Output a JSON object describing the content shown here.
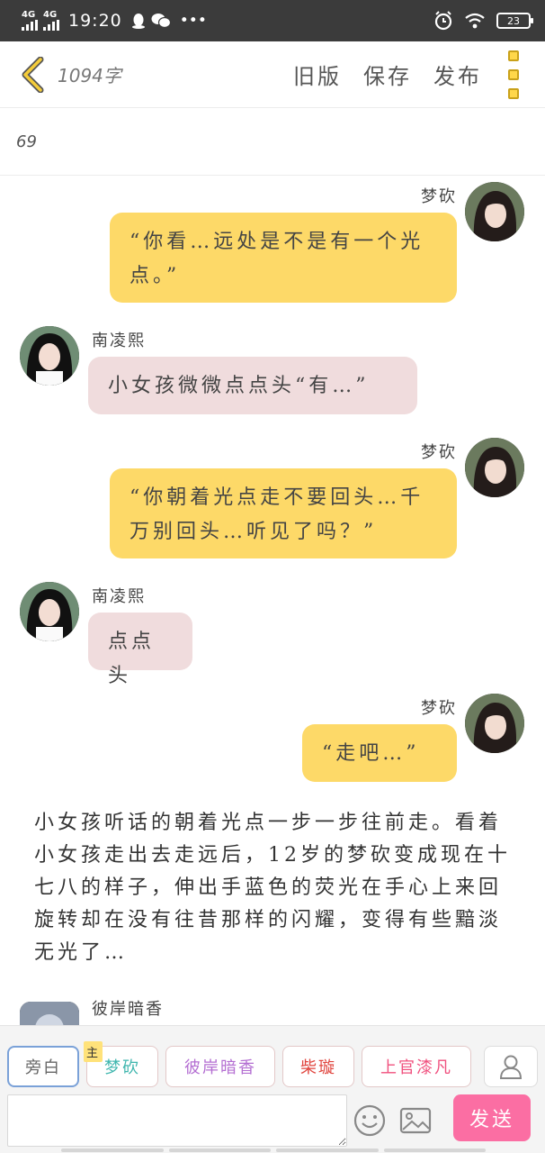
{
  "status_bar": {
    "network_1": "4G",
    "network_2": "4G",
    "time": "19:20",
    "extra": "•••",
    "battery": "23"
  },
  "header": {
    "word_count": "1094字",
    "actions": [
      "旧版",
      "保存",
      "发布"
    ]
  },
  "title": "69",
  "messages": [
    {
      "side": "right",
      "name": "梦砍",
      "text": "“你看…远处是不是有一个光点。”"
    },
    {
      "side": "left",
      "name": "南凌熙",
      "text": "小女孩微微点点头“有…”"
    },
    {
      "side": "right",
      "name": "梦砍",
      "text": "“你朝着光点走不要回头…千万别回头…听见了吗？”"
    },
    {
      "side": "left",
      "name": "南凌熙",
      "text": "点点头"
    },
    {
      "side": "right",
      "name": "梦砍",
      "text": "“走吧…”"
    }
  ],
  "narration": "小女孩听话的朝着光点一步一步往前走。看着小女孩走出去走远后，12岁的梦砍变成现在十七八的样子，伸出手蓝色的荧光在手心上来回旋转却在没有往昔那样的闪耀，变得有些黯淡无光了…",
  "partial_message": {
    "name": "彼岸暗香"
  },
  "roles": [
    {
      "label": "旁白",
      "color": "#666666",
      "active": true
    },
    {
      "label": "梦砍",
      "color": "#3fb6ae",
      "badge": "主"
    },
    {
      "label": "彼岸暗香",
      "color": "#b46fd2"
    },
    {
      "label": "柴璇",
      "color": "#e0453e"
    },
    {
      "label": "上官漆凡",
      "color": "#f0507e"
    }
  ],
  "input": {
    "value": "",
    "placeholder": ""
  },
  "send_label": "发送",
  "icons": {
    "back": "back-chevron-icon",
    "more": "more-menu-icon",
    "user": "user-icon",
    "emoji": "emoji-icon",
    "image": "image-icon"
  },
  "colors": {
    "right_bubble": "#fdd968",
    "left_bubble": "#f0dcdd",
    "send_button": "#fb6ea3",
    "accent_yellow": "#ffd74a"
  }
}
